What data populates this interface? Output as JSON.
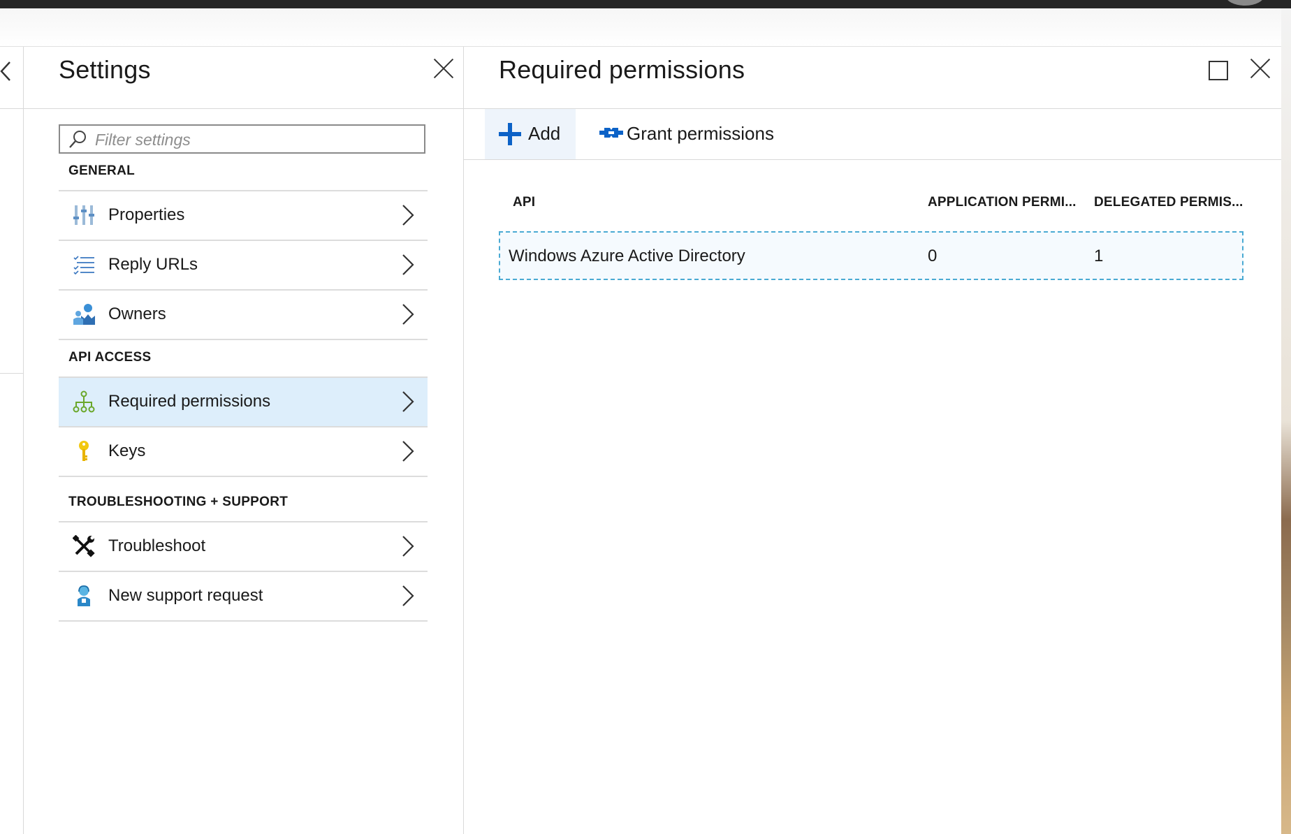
{
  "settings": {
    "title": "Settings",
    "filter_placeholder": "Filter settings",
    "sections": [
      {
        "title": "GENERAL",
        "items": [
          {
            "label": "Properties",
            "icon": "properties-sliders-icon"
          },
          {
            "label": "Reply URLs",
            "icon": "list-checks-icon"
          },
          {
            "label": "Owners",
            "icon": "owners-people-icon"
          }
        ]
      },
      {
        "title": "API ACCESS",
        "items": [
          {
            "label": "Required permissions",
            "icon": "hierarchy-icon",
            "selected": true
          },
          {
            "label": "Keys",
            "icon": "key-icon"
          }
        ]
      },
      {
        "title": "TROUBLESHOOTING + SUPPORT",
        "items": [
          {
            "label": "Troubleshoot",
            "icon": "wrench-screwdriver-icon"
          },
          {
            "label": "New support request",
            "icon": "support-person-icon"
          }
        ]
      }
    ]
  },
  "required_permissions": {
    "title": "Required permissions",
    "commands": {
      "add_label": "Add",
      "grant_label": "Grant permissions"
    },
    "table": {
      "columns": [
        "API",
        "APPLICATION PERMI...",
        "DELEGATED PERMIS..."
      ],
      "rows": [
        {
          "api": "Windows Azure Active Directory",
          "application_permissions": "0",
          "delegated_permissions": "1"
        }
      ]
    }
  },
  "colors": {
    "accent_blue": "#0c62c7",
    "selected_bg": "#ddeefb",
    "row_focus_border": "#4aaad3",
    "top_bar": "#262626"
  }
}
